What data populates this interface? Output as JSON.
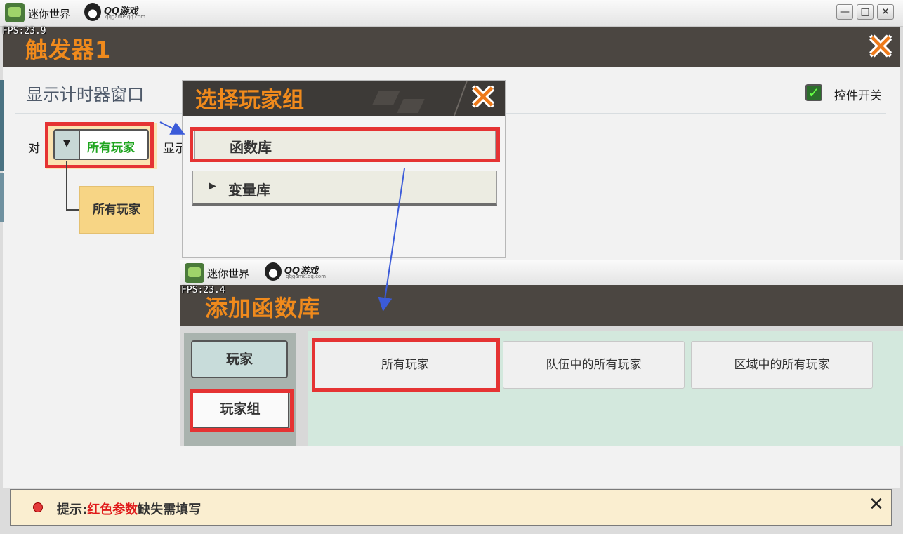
{
  "window": {
    "app_name": "迷你世界",
    "qq_logo": "QQ游戏",
    "qq_domain": "qqgame.qq.com",
    "minimize_glyph": "—",
    "maximize_glyph": "□",
    "close_glyph": "✕",
    "fps": "FPS:23.9"
  },
  "editor": {
    "title": "触发器1",
    "close_glyph": "✕",
    "subtitle": "显示计时器窗口",
    "toggle_label": "控件开关",
    "toggle_checked": true,
    "row_prefix": "对",
    "row_after": "显示",
    "dropdown_value": "所有玩家",
    "tree_node": "所有玩家"
  },
  "popup_group": {
    "title": "选择玩家组",
    "close_glyph": "✕",
    "items": [
      {
        "label": "函数库",
        "expandable": false,
        "highlighted": true
      },
      {
        "label": "变量库",
        "expandable": true,
        "highlighted": false
      }
    ]
  },
  "add_library": {
    "app_name": "迷你世界",
    "qq_logo": "QQ游戏",
    "qq_domain": "qqgame.qq.com",
    "fps": "FPS:23.4",
    "title": "添加函数库",
    "sidebar": [
      {
        "label": "玩家",
        "highlighted": false
      },
      {
        "label": "玩家组",
        "highlighted": true
      }
    ],
    "cards": [
      {
        "label": "所有玩家",
        "highlighted": true
      },
      {
        "label": "队伍中的所有玩家",
        "highlighted": false
      },
      {
        "label": "区域中的所有玩家",
        "highlighted": false
      }
    ]
  },
  "hint": {
    "prefix": "提示:",
    "red_text": "红色参数",
    "suffix": "缺失需填写",
    "close_glyph": "✕"
  },
  "colors": {
    "accent_orange": "#f08a1c",
    "header_bg": "#4b4641",
    "highlight_red": "#e53333",
    "value_green": "#1fa51f"
  }
}
